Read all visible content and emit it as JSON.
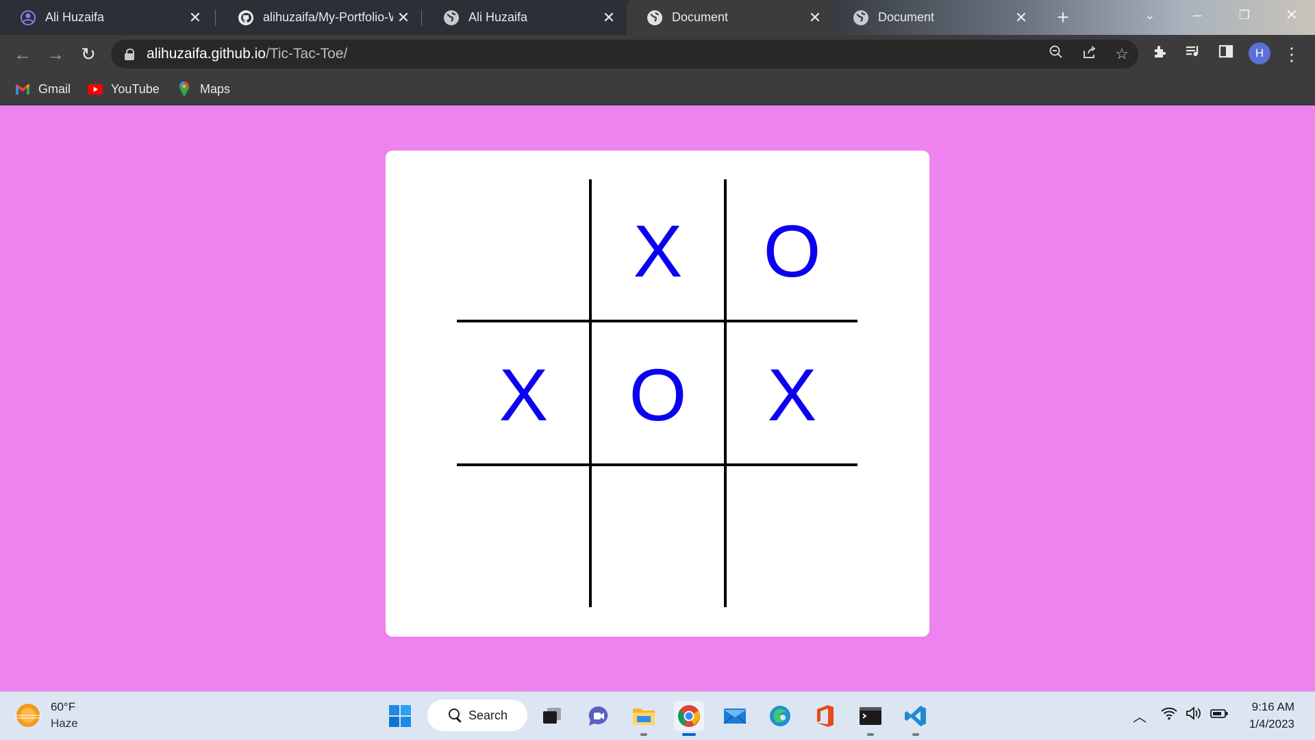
{
  "browser": {
    "tabs": [
      {
        "title": "Ali Huzaifa",
        "icon": "profile-icon",
        "active": false
      },
      {
        "title": "alihuzaifa/My-Portfolio-W",
        "icon": "github-icon",
        "active": false
      },
      {
        "title": "Ali Huzaifa",
        "icon": "globe-icon",
        "active": false
      },
      {
        "title": "Document",
        "icon": "globe-icon",
        "active": true
      },
      {
        "title": "Document",
        "icon": "globe-icon",
        "active": false
      }
    ],
    "url_host": "alihuzaifa.github.io",
    "url_path": "/Tic-Tac-Toe/",
    "profile_initial": "H",
    "bookmarks": [
      {
        "label": "Gmail",
        "icon": "gmail-icon"
      },
      {
        "label": "YouTube",
        "icon": "youtube-icon"
      },
      {
        "label": "Maps",
        "icon": "maps-icon"
      }
    ]
  },
  "game": {
    "page_bg": "#ee82ee",
    "mark_color": "#0b00f0",
    "cells": [
      "",
      "X",
      "O",
      "X",
      "O",
      "X",
      "",
      "",
      ""
    ]
  },
  "taskbar": {
    "weather_temp": "60°F",
    "weather_desc": "Haze",
    "search_label": "Search",
    "time": "9:16 AM",
    "date": "1/4/2023"
  }
}
